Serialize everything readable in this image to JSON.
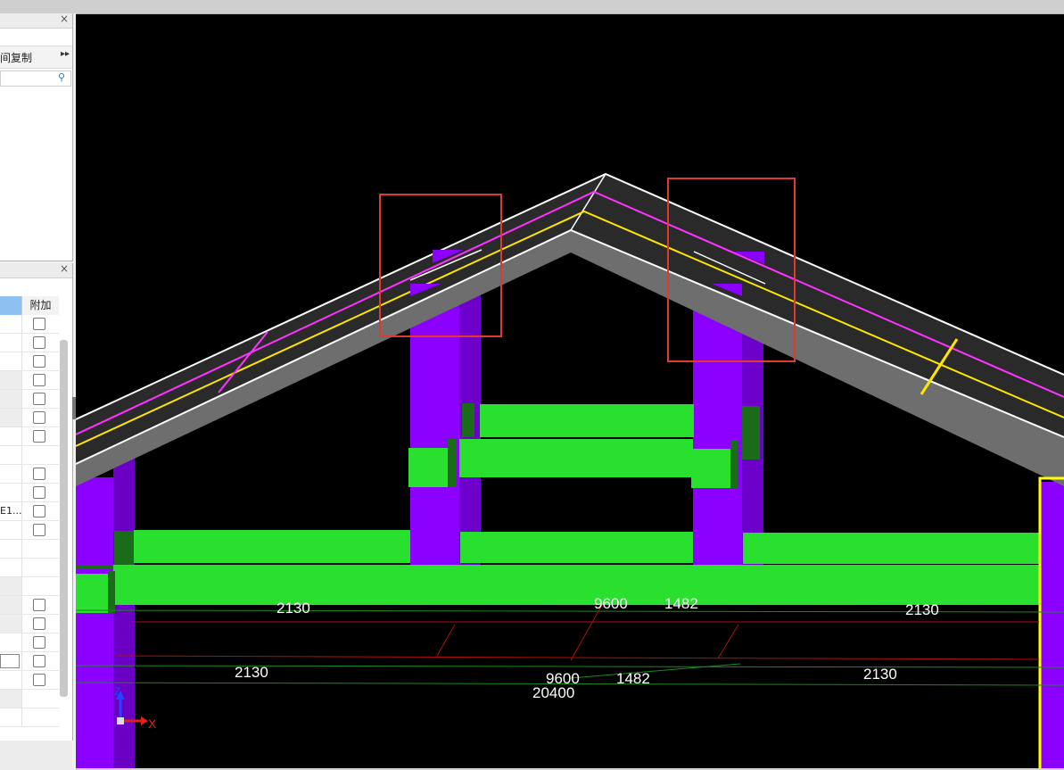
{
  "left_panel": {
    "copy_label": "间复制",
    "column_header": "附加",
    "row_partial_text": "E1..."
  },
  "viewport": {
    "dimensions": {
      "upper_left": "2130",
      "upper_center": "9600",
      "upper_center2": "1482",
      "upper_right": "2130",
      "lower_left": "2130",
      "lower_center": "9600",
      "lower_total": "20400",
      "lower_center2": "1482",
      "lower_right": "2130"
    },
    "axes": {
      "z_label": "Z",
      "x_label": "X"
    },
    "colors": {
      "column": "#8b00ff",
      "beam": "#2ae02f",
      "roof_top": "#2a2a2a",
      "roof_edge": "#6e6e6e",
      "highlight_box": "#e03a2f",
      "selection": "#ffff00"
    }
  },
  "icons": [
    "close-icon",
    "more-arrow-icon",
    "search-icon",
    "axis-gizmo-icon"
  ]
}
